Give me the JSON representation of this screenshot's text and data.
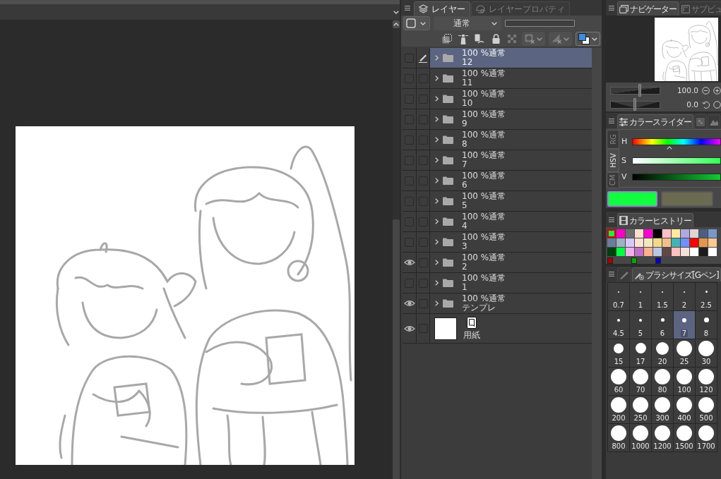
{
  "layer_panel": {
    "tabs": [
      {
        "label": "レイヤー",
        "selected": true
      },
      {
        "label": "レイヤープロパティ",
        "selected": false
      }
    ],
    "blend_mode": "通常",
    "layers": [
      {
        "kind": "folder",
        "blend": "100 %通常",
        "name": "12",
        "visible": false,
        "editing": true,
        "expanded": false,
        "selected": true
      },
      {
        "kind": "folder",
        "blend": "100 %通常",
        "name": "11",
        "visible": false,
        "editing": false,
        "expanded": false,
        "selected": false
      },
      {
        "kind": "folder",
        "blend": "100 %通常",
        "name": "10",
        "visible": false,
        "editing": false,
        "expanded": false,
        "selected": false
      },
      {
        "kind": "folder",
        "blend": "100 %通常",
        "name": "9",
        "visible": false,
        "editing": false,
        "expanded": false,
        "selected": false
      },
      {
        "kind": "folder",
        "blend": "100 %通常",
        "name": "8",
        "visible": false,
        "editing": false,
        "expanded": false,
        "selected": false
      },
      {
        "kind": "folder",
        "blend": "100 %通常",
        "name": "7",
        "visible": false,
        "editing": false,
        "expanded": false,
        "selected": false
      },
      {
        "kind": "folder",
        "blend": "100 %通常",
        "name": "6",
        "visible": false,
        "editing": false,
        "expanded": false,
        "selected": false
      },
      {
        "kind": "folder",
        "blend": "100 %通常",
        "name": "5",
        "visible": false,
        "editing": false,
        "expanded": false,
        "selected": false
      },
      {
        "kind": "folder",
        "blend": "100 %通常",
        "name": "4",
        "visible": false,
        "editing": false,
        "expanded": false,
        "selected": false
      },
      {
        "kind": "folder",
        "blend": "100 %通常",
        "name": "3",
        "visible": false,
        "editing": false,
        "expanded": false,
        "selected": false
      },
      {
        "kind": "folder",
        "blend": "100 %通常",
        "name": "2",
        "visible": true,
        "editing": false,
        "expanded": false,
        "selected": false
      },
      {
        "kind": "folder",
        "blend": "100 %通常",
        "name": "1",
        "visible": false,
        "editing": false,
        "expanded": false,
        "selected": false
      },
      {
        "kind": "folder",
        "blend": "100 %通常",
        "name": "テンプレ",
        "visible": true,
        "editing": false,
        "expanded": false,
        "selected": false
      },
      {
        "kind": "paper",
        "name": "用紙",
        "visible": true,
        "editing": false,
        "selected": false
      }
    ]
  },
  "navigator": {
    "tabs": [
      {
        "label": "ナビゲーター",
        "selected": true
      },
      {
        "label": "サブビュ",
        "selected": false
      }
    ],
    "zoom": {
      "value": "100.0",
      "level": 0.59
    },
    "rotation": {
      "value": "0.0",
      "level": 0.49
    }
  },
  "color_slider": {
    "tabs": [
      {
        "label": "カラースライダー",
        "selected": true
      },
      {
        "selected": false
      },
      {
        "selected": false
      }
    ],
    "modes": [
      {
        "label": "RG",
        "selected": false
      },
      {
        "label": "HSV",
        "selected": true
      },
      {
        "label": "CM",
        "selected": false
      }
    ],
    "sliders": [
      {
        "kind": "hue",
        "label": "H",
        "level": 0.42
      },
      {
        "kind": "saturation",
        "label": "S"
      },
      {
        "kind": "value",
        "label": "V"
      }
    ],
    "colors": [
      {
        "color": "#11ff3e",
        "selected": true
      },
      {
        "color": "#6b6b52",
        "selected": false
      }
    ]
  },
  "color_history": {
    "tabs": [
      {
        "label": "カラーヒストリー",
        "selected": true
      }
    ],
    "swatches": [
      {
        "color": "#1cf040",
        "selected": true
      },
      {
        "color": "#ff00c8",
        "selected": false
      },
      {
        "color": "#6e6e6e",
        "selected": false
      },
      {
        "color": "#ffe0cc",
        "selected": false
      },
      {
        "color": "#ff00d0",
        "selected": false
      },
      {
        "color": "#000000",
        "selected": false
      },
      {
        "color": "#ffc0cb",
        "selected": false
      },
      {
        "color": "#ffeaa0",
        "selected": false
      },
      {
        "color": "#b0a8e0",
        "selected": false
      },
      {
        "color": "#e0d4d4",
        "selected": false
      },
      {
        "color": "#4e5e80",
        "selected": false
      },
      {
        "color": "#7898c8",
        "selected": false
      },
      {
        "color": "#6c7c9c",
        "selected": false
      },
      {
        "color": "#a0b0c4",
        "selected": false
      },
      {
        "color": "#d4c8ff",
        "selected": false
      },
      {
        "color": "#ffe2d2",
        "selected": false
      },
      {
        "color": "#f2e8c0",
        "selected": false
      },
      {
        "color": "#f2d88a",
        "selected": false
      },
      {
        "color": "#f2be88",
        "selected": false
      },
      {
        "color": "#40b4b4",
        "selected": false
      },
      {
        "color": "#7090ff",
        "selected": false
      },
      {
        "color": "#ff0000",
        "selected": false
      },
      {
        "color": "#e09850",
        "selected": false
      },
      {
        "color": "#ffc890",
        "selected": false
      },
      {
        "color": "#004010",
        "selected": false
      },
      {
        "color": "#00ff40",
        "selected": false
      },
      {
        "color": "#f0b0e8",
        "selected": false
      },
      {
        "color": "#c070c8",
        "selected": false
      },
      {
        "color": "#ffb08c",
        "selected": false
      },
      {
        "color": "#b8c8e4",
        "selected": false
      },
      {
        "color": "#604848",
        "selected": false
      },
      {
        "color": "#ffc0c4",
        "selected": false
      },
      {
        "color": "#f2e2d8",
        "selected": false
      },
      {
        "color": "#ffffff",
        "selected": false
      },
      {
        "color": "#1c1c1c",
        "selected": false
      },
      {
        "color": "#ffffff",
        "selected": false
      }
    ],
    "recent": [
      {
        "color": "#aa0000"
      },
      {
        "color": "#00aa00"
      },
      {
        "color": "#0000cc"
      }
    ]
  },
  "brush_size": {
    "tabs": [
      {
        "selected": false
      },
      {
        "label": "ブラシサイズ[Gペン]",
        "selected": true
      }
    ],
    "sizes": [
      {
        "label": "0.7",
        "selected": false
      },
      {
        "label": "1",
        "selected": false
      },
      {
        "label": "1.5",
        "selected": false
      },
      {
        "label": "2",
        "selected": false
      },
      {
        "label": "2.5",
        "selected": false
      },
      {
        "label": "4.5",
        "selected": false
      },
      {
        "label": "5",
        "selected": false
      },
      {
        "label": "6",
        "selected": false
      },
      {
        "label": "7",
        "selected": true
      },
      {
        "label": "8",
        "selected": false
      },
      {
        "label": "15",
        "selected": false
      },
      {
        "label": "17",
        "selected": false
      },
      {
        "label": "20",
        "selected": false
      },
      {
        "label": "25",
        "selected": false
      },
      {
        "label": "30",
        "selected": false
      },
      {
        "label": "60",
        "selected": false
      },
      {
        "label": "70",
        "selected": false
      },
      {
        "label": "80",
        "selected": false
      },
      {
        "label": "100",
        "selected": false
      },
      {
        "label": "120",
        "selected": false
      },
      {
        "label": "200",
        "selected": false
      },
      {
        "label": "250",
        "selected": false
      },
      {
        "label": "300",
        "selected": false
      },
      {
        "label": "400",
        "selected": false
      },
      {
        "label": "500",
        "selected": false
      },
      {
        "label": "800",
        "selected": false
      },
      {
        "label": "1000",
        "selected": false
      },
      {
        "label": "1200",
        "selected": false
      },
      {
        "label": "1500",
        "selected": false
      },
      {
        "label": "1700",
        "selected": false
      }
    ]
  }
}
